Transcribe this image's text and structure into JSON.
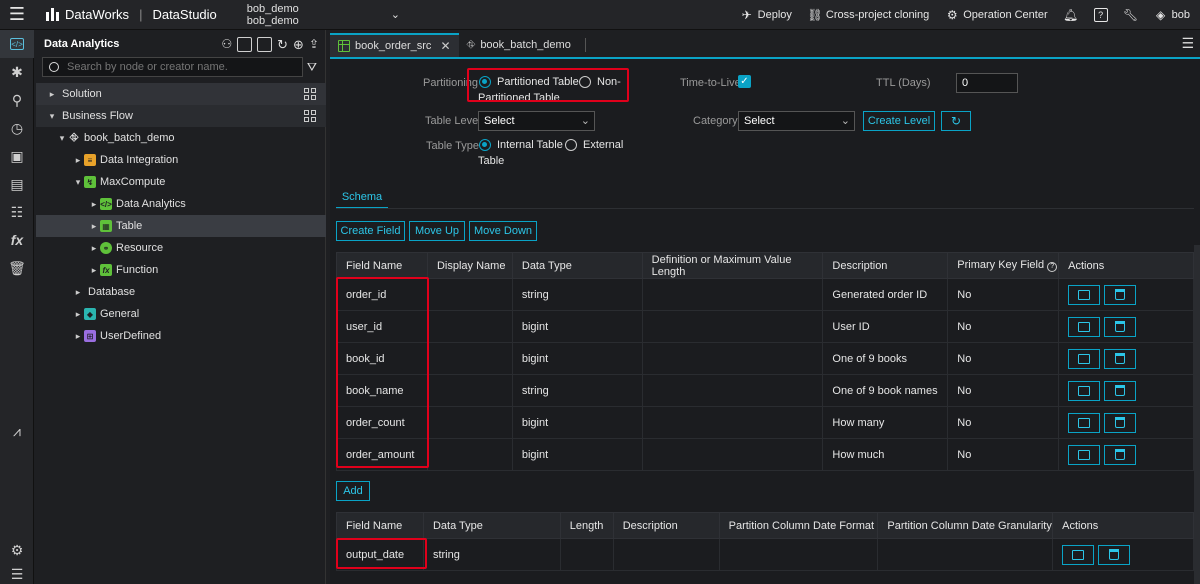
{
  "topbar": {
    "brand": "DataWorks",
    "product": "DataStudio",
    "workspace_line1": "bob_demo",
    "workspace_line2": "bob_demo",
    "actions": [
      {
        "label": "Deploy",
        "icon": "deploy-icon"
      },
      {
        "label": "Cross-project cloning",
        "icon": "clone-icon"
      },
      {
        "label": "Operation Center",
        "icon": "operation-center-icon"
      }
    ],
    "user": "bob"
  },
  "sidebar": {
    "title": "Data Analytics",
    "search_placeholder": "Search by node or creator name.",
    "tree": [
      {
        "label": "Solution",
        "level": 0,
        "caret": "▸"
      },
      {
        "label": "Business Flow",
        "level": 0,
        "caret": "▾"
      },
      {
        "label": "book_batch_demo",
        "level": 1,
        "caret": "▾"
      },
      {
        "label": "Data Integration",
        "level": 2,
        "caret": "▸"
      },
      {
        "label": "MaxCompute",
        "level": 2,
        "caret": "▾"
      },
      {
        "label": "Data Analytics",
        "level": 3,
        "caret": "▸"
      },
      {
        "label": "Table",
        "level": 3,
        "caret": "▸"
      },
      {
        "label": "Resource",
        "level": 3,
        "caret": "▸"
      },
      {
        "label": "Function",
        "level": 3,
        "caret": "▸"
      },
      {
        "label": "Database",
        "level": 2,
        "caret": "▸"
      },
      {
        "label": "General",
        "level": 2,
        "caret": "▸"
      },
      {
        "label": "UserDefined",
        "level": 2,
        "caret": "▸"
      }
    ]
  },
  "tabs": [
    {
      "label": "book_order_src",
      "active": true
    },
    {
      "label": "book_batch_demo",
      "active": false
    }
  ],
  "form": {
    "partitioning_label": "Partitioning",
    "partitioned_label": "Partitioned Table",
    "non_partitioned_label_1": "Non-",
    "non_partitioned_label_2": "Partitioned Table",
    "ttl_toggle_label": "Time-to-Live",
    "ttl_days_label": "TTL (Days)",
    "ttl_days_value": "0",
    "table_level_label": "Table Level",
    "table_level_value": "Select",
    "category_label": "Category",
    "category_value": "Select",
    "create_level_button": "Create Level",
    "table_type_label": "Table Type",
    "internal_label": "Internal Table",
    "external_label_1": "External",
    "external_label_2": "Table"
  },
  "schema": {
    "tab_label": "Schema",
    "buttons": {
      "create_field": "Create Field",
      "move_up": "Move Up",
      "move_down": "Move Down"
    },
    "headers": [
      "Field Name",
      "Display Name",
      "Data Type",
      "Definition or Maximum Value Length",
      "Description",
      "Primary Key Field",
      "Actions"
    ],
    "rows": [
      {
        "field": "order_id",
        "display": "",
        "type": "string",
        "length": "",
        "desc": "Generated order ID",
        "pk": "No"
      },
      {
        "field": "user_id",
        "display": "",
        "type": "bigint",
        "length": "",
        "desc": "User ID",
        "pk": "No"
      },
      {
        "field": "book_id",
        "display": "",
        "type": "bigint",
        "length": "",
        "desc": "One of 9 books",
        "pk": "No"
      },
      {
        "field": "book_name",
        "display": "",
        "type": "string",
        "length": "",
        "desc": "One of 9 book names",
        "pk": "No"
      },
      {
        "field": "order_count",
        "display": "",
        "type": "bigint",
        "length": "",
        "desc": "How many",
        "pk": "No"
      },
      {
        "field": "order_amount",
        "display": "",
        "type": "bigint",
        "length": "",
        "desc": "How much",
        "pk": "No"
      }
    ],
    "add_button": "Add"
  },
  "partition": {
    "headers": [
      "Field Name",
      "Data Type",
      "Length",
      "Description",
      "Partition Column Date Format",
      "Partition Column Date Granularity",
      "Actions"
    ],
    "rows": [
      {
        "field": "output_date",
        "type": "string",
        "length": "",
        "desc": "",
        "format": "",
        "granularity": ""
      }
    ]
  },
  "colors": {
    "accent": "#0aa3c6",
    "highlight": "#e0001b",
    "background": "#1b1c1f"
  }
}
